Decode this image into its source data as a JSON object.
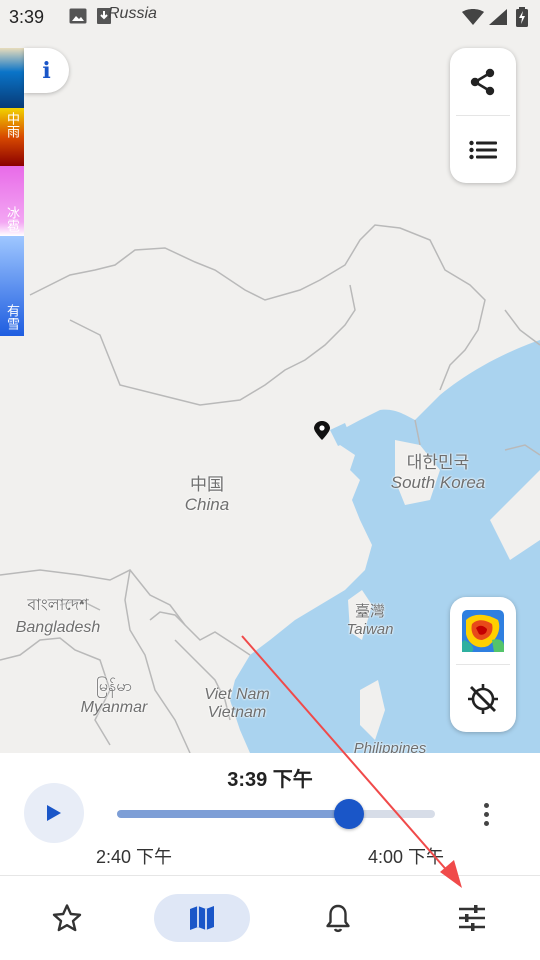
{
  "status_bar": {
    "time": "3:39",
    "region_label": "Russia",
    "icons": [
      "image-icon",
      "download-icon",
      "wifi-icon",
      "signal-icon",
      "battery-charging-icon"
    ]
  },
  "legend": {
    "labels": [
      "中雨",
      "冰雹",
      "有雪"
    ],
    "colors": {
      "rain_top": "#e8dcbb",
      "rain_blue": "#0a74c8",
      "rain_yellow": "#f2d300",
      "rain_red": "#b00000",
      "hail": "#e86be8",
      "snow": "#6aa6ff"
    }
  },
  "info_button": {
    "label": "i",
    "icon": "info-icon"
  },
  "map_controls": {
    "share_icon": "share-icon",
    "list_icon": "list-icon",
    "layer_icon": "radar-layer-icon",
    "locate_icon": "location-disabled-icon"
  },
  "map": {
    "labels": [
      {
        "local": "中国",
        "english": "China"
      },
      {
        "local": "대한민국",
        "english": "South Korea"
      },
      {
        "local": "臺灣",
        "english": "Taiwan"
      },
      {
        "local": "বাংলাদেশ",
        "english": "Bangladesh"
      },
      {
        "local": "မြန်မာ",
        "english": "Myanmar"
      },
      {
        "local": "Viet Nam",
        "english": "Vietnam"
      },
      {
        "local": "Philippines",
        "english": ""
      }
    ],
    "colors": {
      "land": "#f1f0ee",
      "sea": "#aad3ef",
      "border": "#b9b9b9"
    }
  },
  "playback": {
    "current_time": "3:39 下午",
    "start_time": "2:40 下午",
    "end_time": "4:00 下午",
    "progress": 0.73,
    "accent": "#1a56c8"
  },
  "bottom_nav": {
    "items": [
      {
        "name": "favorites",
        "icon": "star-icon"
      },
      {
        "name": "map",
        "icon": "map-icon",
        "active": true
      },
      {
        "name": "alerts",
        "icon": "bell-icon"
      },
      {
        "name": "settings",
        "icon": "sliders-icon"
      }
    ]
  },
  "annotation": {
    "color": "#f04a4a"
  }
}
